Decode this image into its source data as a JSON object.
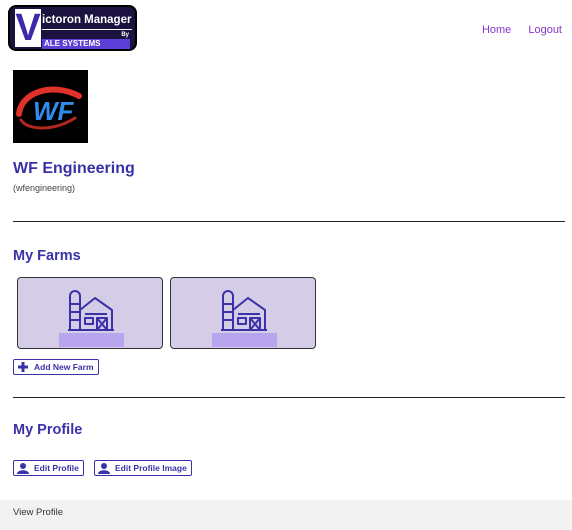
{
  "brand": {
    "initial": "V",
    "top_text": "ictoron Manager",
    "bottom_text": "ALE SYSTEMS",
    "by_text": "By"
  },
  "nav": {
    "home": "Home",
    "logout": "Logout"
  },
  "company": {
    "logo_text": "WF",
    "name": "WF Engineering",
    "handle": "(wfengineering)"
  },
  "farms": {
    "title": "My Farms",
    "items": [
      {
        "label": ""
      },
      {
        "label": ""
      }
    ],
    "add_label": "Add New Farm"
  },
  "profile": {
    "title": "My Profile",
    "edit_profile": "Edit Profile",
    "edit_image": "Edit Profile Image"
  },
  "footer": {
    "text": "View Profile"
  },
  "colors": {
    "accent": "#3b31a8",
    "nav_link": "#8a35c7",
    "card_bg": "#d5cde8",
    "label_bg": "#b7a5ee"
  }
}
